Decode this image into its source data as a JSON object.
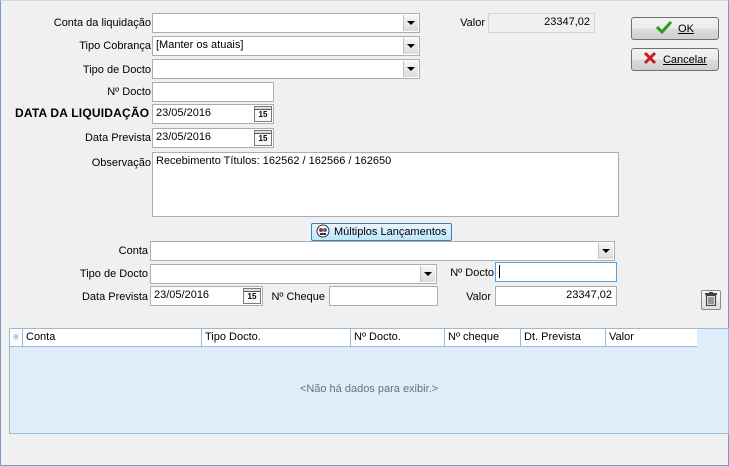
{
  "form": {
    "conta_label": "Conta da liquidação",
    "conta_value": "",
    "valor_label": "Valor",
    "valor_value": "23347,02",
    "tipo_cobranca_label": "Tipo Cobrança",
    "tipo_cobranca_value": "[Manter os atuais]",
    "tipo_docto_label": "Tipo de Docto",
    "tipo_docto_value": "",
    "n_docto_label": "Nº Docto",
    "n_docto_value": "",
    "data_liquidacao_label": "DATA DA LIQUIDAÇÃO",
    "data_liquidacao_value": "23/05/2016",
    "data_prevista_label": "Data Prevista",
    "data_prevista_value": "23/05/2016",
    "observacao_label": "Observação",
    "observacao_value": "Recebimento Títulos: 162562 / 162566 / 162650"
  },
  "buttons": {
    "ok_label": "OK",
    "cancelar_label": "Cancelar",
    "multiplos_label": "Múltiplos Lançamentos"
  },
  "lancamento": {
    "conta_label": "Conta",
    "conta_value": "",
    "tipo_docto_label": "Tipo de Docto",
    "tipo_docto_value": "",
    "n_docto_label": "Nº Docto",
    "n_docto_value": "",
    "data_prevista_label": "Data Prevista",
    "data_prevista_value": "23/05/2016",
    "n_cheque_label": "Nº Cheque",
    "n_cheque_value": "",
    "valor_label": "Valor",
    "valor_value": "23347,02"
  },
  "grid": {
    "columns": [
      "Conta",
      "Tipo Docto.",
      "Nº Docto.",
      "Nº cheque",
      "Dt. Prevista",
      "Valor"
    ],
    "empty_message": "<Não há dados para exibir.>"
  },
  "calendar_glyph": "15",
  "colors": {
    "ok_check": "#2a9d1c",
    "cancel_x": "#c81e1e",
    "grid_bg": "#dfecf9"
  }
}
